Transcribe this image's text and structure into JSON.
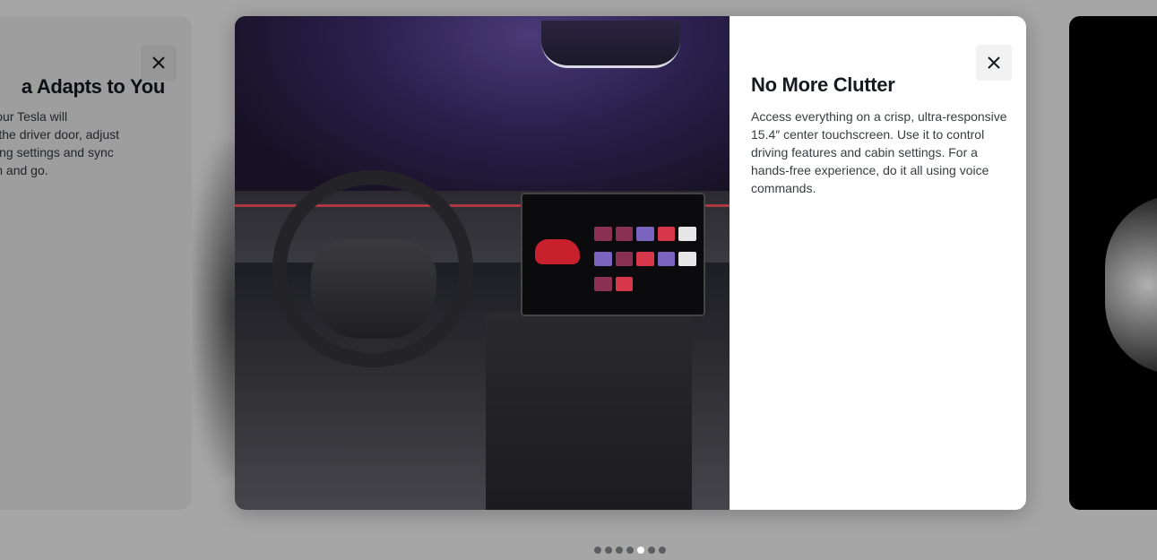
{
  "carousel": {
    "prev_card": {
      "title": "a Adapts to You",
      "body": "k up, your Tesla will unlock the driver door, adjust ed driving settings and sync st get in and go.",
      "close_icon": "close-icon"
    },
    "active_card": {
      "title": "No More Clutter",
      "body": "Access everything on a crisp, ultra-responsive 15.4″ center touchscreen. Use it to control driving features and cabin settings. For a hands-free experience, do it all using voice commands.",
      "image": "interior-cockpit-photo",
      "close_icon": "close-icon"
    },
    "next_card": {
      "image": "next-feature-photo"
    },
    "pagination": {
      "count": 7,
      "active_index": 4
    }
  },
  "colors": {
    "overlay": "#a6a6a6",
    "title": "#171a20",
    "body_text": "#393c41",
    "dot_inactive": "#5c5e62",
    "dot_active": "#ffffff"
  }
}
